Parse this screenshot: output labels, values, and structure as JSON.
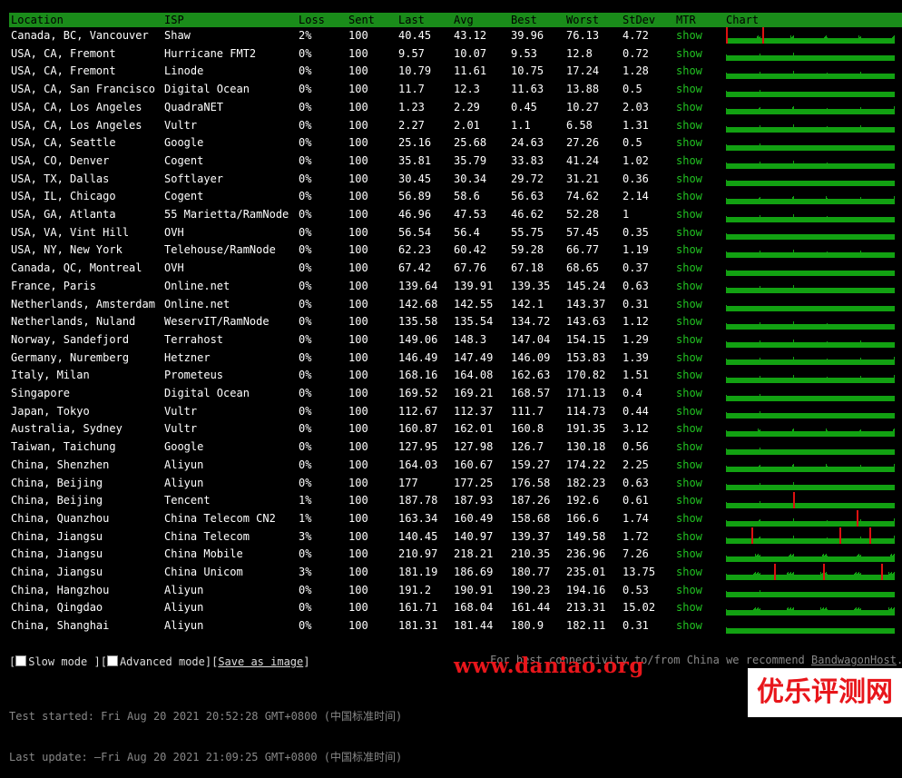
{
  "headers": {
    "location": "Location",
    "isp": "ISP",
    "loss": "Loss",
    "sent": "Sent",
    "last": "Last",
    "avg": "Avg",
    "best": "Best",
    "worst": "Worst",
    "stdev": "StDev",
    "mtr": "MTR",
    "chart": "Chart"
  },
  "rows": [
    {
      "location": "Canada, BC, Vancouver",
      "isp": "Shaw",
      "loss": "2%",
      "sent": "100",
      "last": "40.45",
      "avg": "43.12",
      "best": "39.96",
      "worst": "76.13",
      "stdev": "4.72",
      "mtr": "show",
      "spikes": [
        0.0,
        0.22
      ]
    },
    {
      "location": "USA, CA, Fremont",
      "isp": "Hurricane FMT2",
      "loss": "0%",
      "sent": "100",
      "last": "9.57",
      "avg": "10.07",
      "best": "9.53",
      "worst": "12.8",
      "stdev": "0.72",
      "mtr": "show",
      "spikes": []
    },
    {
      "location": "USA, CA, Fremont",
      "isp": "Linode",
      "loss": "0%",
      "sent": "100",
      "last": "10.79",
      "avg": "11.61",
      "best": "10.75",
      "worst": "17.24",
      "stdev": "1.28",
      "mtr": "show",
      "spikes": []
    },
    {
      "location": "USA, CA, San Francisco",
      "isp": "Digital Ocean",
      "loss": "0%",
      "sent": "100",
      "last": "11.7",
      "avg": "12.3",
      "best": "11.63",
      "worst": "13.88",
      "stdev": "0.5",
      "mtr": "show",
      "spikes": []
    },
    {
      "location": "USA, CA, Los Angeles",
      "isp": "QuadraNET",
      "loss": "0%",
      "sent": "100",
      "last": "1.23",
      "avg": "2.29",
      "best": "0.45",
      "worst": "10.27",
      "stdev": "2.03",
      "mtr": "show",
      "spikes": []
    },
    {
      "location": "USA, CA, Los Angeles",
      "isp": "Vultr",
      "loss": "0%",
      "sent": "100",
      "last": "2.27",
      "avg": "2.01",
      "best": "1.1",
      "worst": "6.58",
      "stdev": "1.31",
      "mtr": "show",
      "spikes": []
    },
    {
      "location": "USA, CA, Seattle",
      "isp": "Google",
      "loss": "0%",
      "sent": "100",
      "last": "25.16",
      "avg": "25.68",
      "best": "24.63",
      "worst": "27.26",
      "stdev": "0.5",
      "mtr": "show",
      "spikes": []
    },
    {
      "location": "USA, CO, Denver",
      "isp": "Cogent",
      "loss": "0%",
      "sent": "100",
      "last": "35.81",
      "avg": "35.79",
      "best": "33.83",
      "worst": "41.24",
      "stdev": "1.02",
      "mtr": "show",
      "spikes": []
    },
    {
      "location": "USA, TX, Dallas",
      "isp": "Softlayer",
      "loss": "0%",
      "sent": "100",
      "last": "30.45",
      "avg": "30.34",
      "best": "29.72",
      "worst": "31.21",
      "stdev": "0.36",
      "mtr": "show",
      "spikes": []
    },
    {
      "location": "USA, IL, Chicago",
      "isp": "Cogent",
      "loss": "0%",
      "sent": "100",
      "last": "56.89",
      "avg": "58.6",
      "best": "56.63",
      "worst": "74.62",
      "stdev": "2.14",
      "mtr": "show",
      "spikes": []
    },
    {
      "location": "USA, GA, Atlanta",
      "isp": "55 Marietta/RamNode",
      "loss": "0%",
      "sent": "100",
      "last": "46.96",
      "avg": "47.53",
      "best": "46.62",
      "worst": "52.28",
      "stdev": "1",
      "mtr": "show",
      "spikes": []
    },
    {
      "location": "USA, VA, Vint Hill",
      "isp": "OVH",
      "loss": "0%",
      "sent": "100",
      "last": "56.54",
      "avg": "56.4",
      "best": "55.75",
      "worst": "57.45",
      "stdev": "0.35",
      "mtr": "show",
      "spikes": []
    },
    {
      "location": "USA, NY, New York",
      "isp": "Telehouse/RamNode",
      "loss": "0%",
      "sent": "100",
      "last": "62.23",
      "avg": "60.42",
      "best": "59.28",
      "worst": "66.77",
      "stdev": "1.19",
      "mtr": "show",
      "spikes": []
    },
    {
      "location": "Canada, QC, Montreal",
      "isp": "OVH",
      "loss": "0%",
      "sent": "100",
      "last": "67.42",
      "avg": "67.76",
      "best": "67.18",
      "worst": "68.65",
      "stdev": "0.37",
      "mtr": "show",
      "spikes": []
    },
    {
      "location": "France, Paris",
      "isp": "Online.net",
      "loss": "0%",
      "sent": "100",
      "last": "139.64",
      "avg": "139.91",
      "best": "139.35",
      "worst": "145.24",
      "stdev": "0.63",
      "mtr": "show",
      "spikes": []
    },
    {
      "location": "Netherlands, Amsterdam",
      "isp": "Online.net",
      "loss": "0%",
      "sent": "100",
      "last": "142.68",
      "avg": "142.55",
      "best": "142.1",
      "worst": "143.37",
      "stdev": "0.31",
      "mtr": "show",
      "spikes": []
    },
    {
      "location": "Netherlands, Nuland",
      "isp": "WeservIT/RamNode",
      "loss": "0%",
      "sent": "100",
      "last": "135.58",
      "avg": "135.54",
      "best": "134.72",
      "worst": "143.63",
      "stdev": "1.12",
      "mtr": "show",
      "spikes": []
    },
    {
      "location": "Norway, Sandefjord",
      "isp": "Terrahost",
      "loss": "0%",
      "sent": "100",
      "last": "149.06",
      "avg": "148.3",
      "best": "147.04",
      "worst": "154.15",
      "stdev": "1.29",
      "mtr": "show",
      "spikes": []
    },
    {
      "location": "Germany, Nuremberg",
      "isp": "Hetzner",
      "loss": "0%",
      "sent": "100",
      "last": "146.49",
      "avg": "147.49",
      "best": "146.09",
      "worst": "153.83",
      "stdev": "1.39",
      "mtr": "show",
      "spikes": []
    },
    {
      "location": "Italy, Milan",
      "isp": "Prometeus",
      "loss": "0%",
      "sent": "100",
      "last": "168.16",
      "avg": "164.08",
      "best": "162.63",
      "worst": "170.82",
      "stdev": "1.51",
      "mtr": "show",
      "spikes": []
    },
    {
      "location": "Singapore",
      "isp": "Digital Ocean",
      "loss": "0%",
      "sent": "100",
      "last": "169.52",
      "avg": "169.21",
      "best": "168.57",
      "worst": "171.13",
      "stdev": "0.4",
      "mtr": "show",
      "spikes": []
    },
    {
      "location": "Japan, Tokyo",
      "isp": "Vultr",
      "loss": "0%",
      "sent": "100",
      "last": "112.67",
      "avg": "112.37",
      "best": "111.7",
      "worst": "114.73",
      "stdev": "0.44",
      "mtr": "show",
      "spikes": []
    },
    {
      "location": "Australia, Sydney",
      "isp": "Vultr",
      "loss": "0%",
      "sent": "100",
      "last": "160.87",
      "avg": "162.01",
      "best": "160.8",
      "worst": "191.35",
      "stdev": "3.12",
      "mtr": "show",
      "spikes": []
    },
    {
      "location": "Taiwan, Taichung",
      "isp": "Google",
      "loss": "0%",
      "sent": "100",
      "last": "127.95",
      "avg": "127.98",
      "best": "126.7",
      "worst": "130.18",
      "stdev": "0.56",
      "mtr": "show",
      "spikes": []
    },
    {
      "location": "China, Shenzhen",
      "isp": "Aliyun",
      "loss": "0%",
      "sent": "100",
      "last": "164.03",
      "avg": "160.67",
      "best": "159.27",
      "worst": "174.22",
      "stdev": "2.25",
      "mtr": "show",
      "spikes": []
    },
    {
      "location": "China, Beijing",
      "isp": "Aliyun",
      "loss": "0%",
      "sent": "100",
      "last": "177",
      "avg": "177.25",
      "best": "176.58",
      "worst": "182.23",
      "stdev": "0.63",
      "mtr": "show",
      "spikes": []
    },
    {
      "location": "China, Beijing",
      "isp": "Tencent",
      "loss": "1%",
      "sent": "100",
      "last": "187.78",
      "avg": "187.93",
      "best": "187.26",
      "worst": "192.6",
      "stdev": "0.61",
      "mtr": "show",
      "spikes": [
        0.4
      ]
    },
    {
      "location": "China, Quanzhou",
      "isp": "China Telecom CN2",
      "loss": "1%",
      "sent": "100",
      "last": "163.34",
      "avg": "160.49",
      "best": "158.68",
      "worst": "166.6",
      "stdev": "1.74",
      "mtr": "show",
      "spikes": [
        0.78
      ]
    },
    {
      "location": "China, Jiangsu",
      "isp": "China Telecom",
      "loss": "3%",
      "sent": "100",
      "last": "140.45",
      "avg": "140.97",
      "best": "139.37",
      "worst": "149.58",
      "stdev": "1.72",
      "mtr": "show",
      "spikes": [
        0.15,
        0.68,
        0.86
      ]
    },
    {
      "location": "China, Jiangsu",
      "isp": "China Mobile",
      "loss": "0%",
      "sent": "100",
      "last": "210.97",
      "avg": "218.21",
      "best": "210.35",
      "worst": "236.96",
      "stdev": "7.26",
      "mtr": "show",
      "spikes": []
    },
    {
      "location": "China, Jiangsu",
      "isp": "China Unicom",
      "loss": "3%",
      "sent": "100",
      "last": "181.19",
      "avg": "186.69",
      "best": "180.77",
      "worst": "235.01",
      "stdev": "13.75",
      "mtr": "show",
      "spikes": [
        0.29,
        0.58,
        0.93
      ]
    },
    {
      "location": "China, Hangzhou",
      "isp": "Aliyun",
      "loss": "0%",
      "sent": "100",
      "last": "191.2",
      "avg": "190.91",
      "best": "190.23",
      "worst": "194.16",
      "stdev": "0.53",
      "mtr": "show",
      "spikes": []
    },
    {
      "location": "China, Qingdao",
      "isp": "Aliyun",
      "loss": "0%",
      "sent": "100",
      "last": "161.71",
      "avg": "168.04",
      "best": "161.44",
      "worst": "213.31",
      "stdev": "15.02",
      "mtr": "show",
      "spikes": []
    },
    {
      "location": "China, Shanghai",
      "isp": "Aliyun",
      "loss": "0%",
      "sent": "100",
      "last": "181.31",
      "avg": "181.44",
      "best": "180.9",
      "worst": "182.11",
      "stdev": "0.31",
      "mtr": "show",
      "spikes": []
    }
  ],
  "controls": {
    "slow_mode": "Slow mode",
    "advanced_mode": "Advanced mode",
    "save_image": "Save as image"
  },
  "recommend": {
    "text": "For best connectivity to/from China we recommend ",
    "link": "BandwagonHost",
    "suffix": "."
  },
  "meta": {
    "test_started": "Test started: Fri Aug 20 2021 20:52:28 GMT+0800 (中国标准时间)",
    "last_update": "Last update: —Fri Aug 20 2021 21:09:25 GMT+0800 (中国标准时间)"
  },
  "watermarks": {
    "site": "www.daniao.org",
    "brand": "优乐评测网"
  },
  "colors": {
    "header_bg": "#1a8c1a",
    "mtr_link": "#22c322",
    "chart_bar": "#12a112",
    "loss_spike": "#dd1111",
    "watermark_red": "#e8161b"
  }
}
